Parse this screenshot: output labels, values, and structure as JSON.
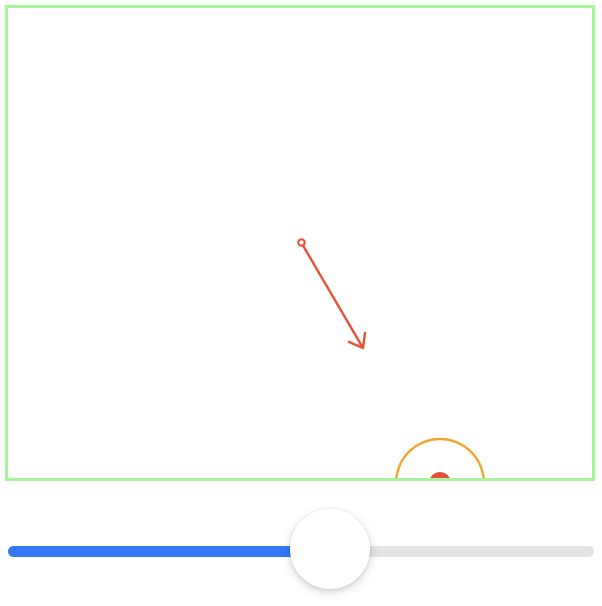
{
  "colors": {
    "canvas_border": "#a6f59a",
    "arrow": "#e8503a",
    "target_ring": "#f2a42c",
    "target_dot": "#e8503a",
    "slider_fill": "#3478f6",
    "slider_track": "#e3e3e6",
    "slider_thumb": "#ffffff"
  },
  "slider": {
    "value": 0.55
  }
}
